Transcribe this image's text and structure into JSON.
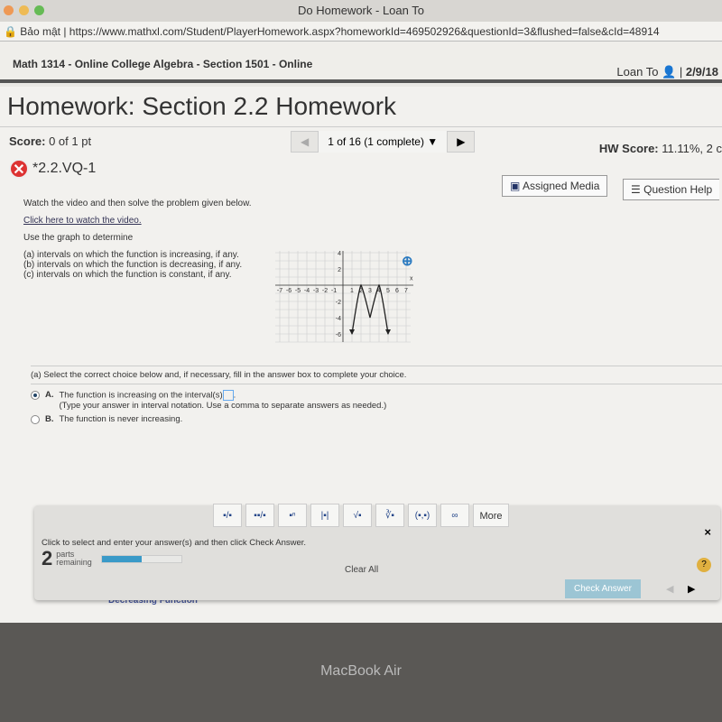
{
  "window": {
    "title": "Do Homework - Loan To",
    "security": "Bảo mật",
    "url": "https://www.mathxl.com/Student/PlayerHomework.aspx?homeworkId=469502926&questionId=3&flushed=false&cId=48914"
  },
  "course": {
    "name": "Math 1314 - Online College Algebra - Section 1501 - Online",
    "user": "Loan To",
    "date": "2/9/18"
  },
  "page": {
    "title": "Homework: Section 2.2 Homework",
    "score_label": "Score:",
    "score": "0 of 1 pt",
    "nav": "1 of 16 (1 complete)",
    "hw_score_label": "HW Score:",
    "hw_score": "11.11%, 2 c",
    "question_id": "*2.2.VQ-1",
    "assigned_media": "Assigned Media",
    "question_help": "Question Help"
  },
  "question": {
    "intro": "Watch the video and then solve the problem given below.",
    "video_link": "Click here to watch the video.",
    "prompt": "Use the graph to determine",
    "items": [
      "(a) intervals on which the function is increasing, if any.",
      "(b) intervals on which the function is decreasing, if any.",
      "(c) intervals on which the function is constant, if any."
    ],
    "graph": {
      "xlabel": "x",
      "ylabel": "y",
      "x_ticks": [
        "-7",
        "-6",
        "-5",
        "-4",
        "-3",
        "-2",
        "-1",
        "1",
        "2",
        "3",
        "4",
        "5",
        "6",
        "7"
      ],
      "y_ticks": [
        "4",
        "2",
        "-2",
        "-4",
        "-6"
      ],
      "points": [
        [
          1,
          -6
        ],
        [
          2,
          0
        ],
        [
          3,
          -4
        ],
        [
          4,
          0
        ],
        [
          5,
          -6
        ]
      ]
    }
  },
  "part_a": {
    "instruction": "(a) Select the correct choice below and, if necessary, fill in the answer box to complete your choice.",
    "choice_a_letter": "A.",
    "choice_a": "The function is increasing on the interval(s)",
    "choice_a_note": "(Type your answer in interval notation. Use a comma to separate answers as needed.)",
    "choice_b_letter": "B.",
    "choice_b": "The function is never increasing.",
    "selected": "A"
  },
  "panel": {
    "tools": [
      "▪/▪",
      "▪▪/▪",
      "▪ⁿ",
      "|▪|",
      "√▪",
      "∛▪",
      "(▪,▪)",
      "∞"
    ],
    "more": "More",
    "hint": "Click to select and enter your answer(s) and then click Check Answer.",
    "parts_count": "2",
    "parts_label1": "parts",
    "parts_label2": "remaining",
    "progress_percent": 50,
    "clear_all": "Clear All",
    "check_answer": "Check Answer",
    "help": "?",
    "close": "×"
  },
  "background": {
    "caption": "Decreasing Function"
  },
  "device": {
    "label": "MacBook Air"
  }
}
